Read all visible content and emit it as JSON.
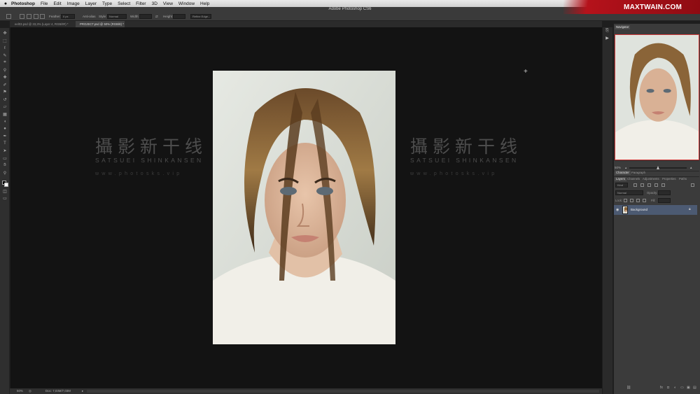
{
  "menubar": {
    "apple": "",
    "items": [
      "Photoshop",
      "File",
      "Edit",
      "Image",
      "Layer",
      "Type",
      "Select",
      "Filter",
      "3D",
      "View",
      "Window",
      "Help"
    ]
  },
  "brand": {
    "text": "MAXTWAIN.COM",
    "color": "#b5121b"
  },
  "app_title": "Adobe Photoshop CS6",
  "options_bar": {
    "feather_label": "Feather:",
    "feather_value": "0 px",
    "antialias_label": "Anti-alias",
    "style_label": "Style:",
    "style_value": "Normal",
    "width_label": "Width:",
    "height_label": "Height:",
    "refine_button": "Refine Edge..."
  },
  "tabs": [
    {
      "label": "eel03.psd @ 33,3% (Layer 4, RGB/8#) *",
      "active": false
    },
    {
      "label": "PROJECT.psd @ 50% (RGB/8) *",
      "active": true
    }
  ],
  "tools": [
    "move-icon",
    "marquee-icon",
    "lasso-icon",
    "quick-select-icon",
    "crop-icon",
    "eyedropper-icon",
    "healing-brush-icon",
    "brush-icon",
    "clone-stamp-icon",
    "history-brush-icon",
    "eraser-icon",
    "gradient-icon",
    "blur-icon",
    "dodge-icon",
    "pen-icon",
    "type-icon",
    "path-select-icon",
    "shape-icon",
    "hand-icon",
    "zoom-icon"
  ],
  "watermark": {
    "chinese": "攝影新干线",
    "english": "SATSUEI SHINKANSEN",
    "url": "www.photosks.vip"
  },
  "statusbar": {
    "zoom": "50%",
    "doc": "Doc: 7,03M/7,03M"
  },
  "navigator": {
    "tab": "Navigator",
    "zoom": "50%"
  },
  "char_panel": {
    "tabs": [
      "Character",
      "Paragraph"
    ]
  },
  "layers_panel": {
    "tabs": [
      "Layers",
      "Channels",
      "Adjustments",
      "Properties",
      "Paths"
    ],
    "kind": "Kind",
    "blend_mode": "Normal",
    "opacity_label": "Opacity:",
    "lock_label": "Lock:",
    "fill_label": "Fill:",
    "layer_name": "Background"
  },
  "colors": {
    "canvas": "#131313",
    "panel": "#3b3b3b",
    "selected_layer": "#4c5a72",
    "nav_border": "#d23a3a"
  }
}
